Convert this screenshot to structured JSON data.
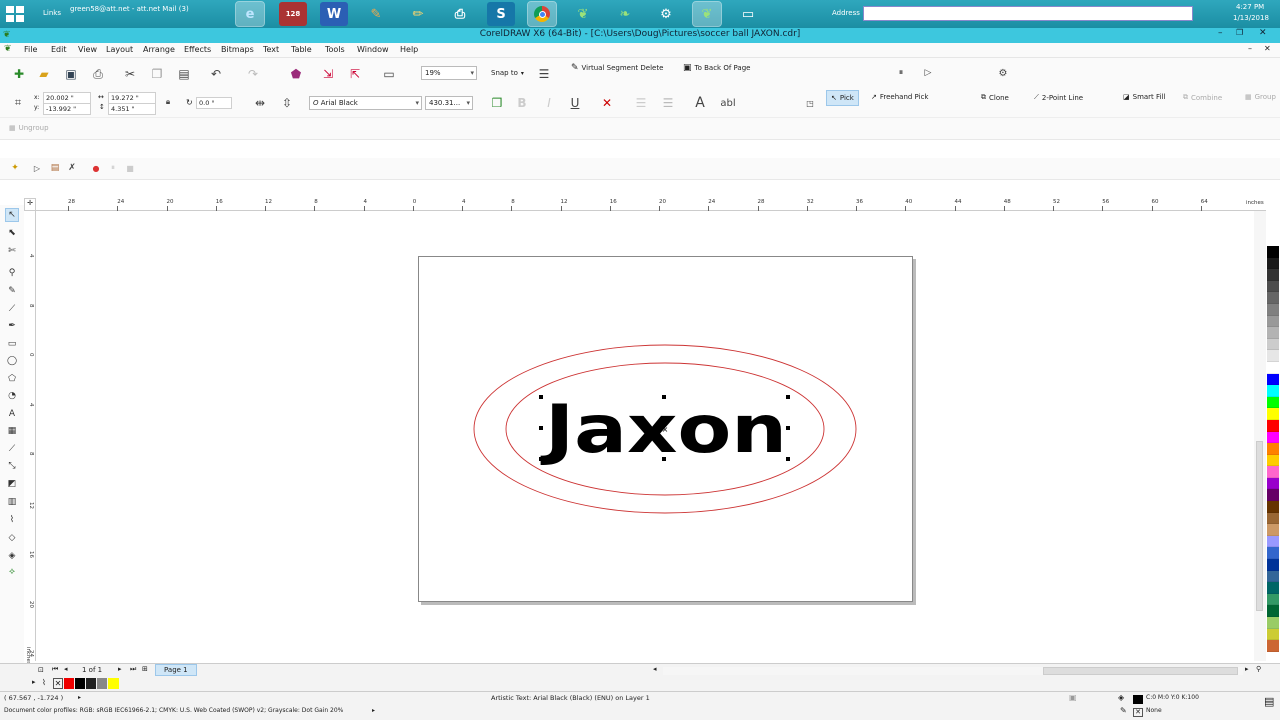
{
  "taskbar": {
    "bookmark_links": "Links",
    "mail_tab": "green58@att.net - att.net Mail (3)",
    "calendar_day": "128",
    "address_label": "Address",
    "clock_time": "4:27 PM",
    "clock_date": "1/13/2018"
  },
  "window": {
    "title": "CorelDRAW X6 (64-Bit) - [C:\\Users\\Doug\\Pictures\\soccer ball JAXON.cdr]"
  },
  "menu": [
    "File",
    "Edit",
    "View",
    "Layout",
    "Arrange",
    "Effects",
    "Bitmaps",
    "Text",
    "Table",
    "Tools",
    "Window",
    "Help"
  ],
  "standard_bar": {
    "zoom": "19%",
    "snap_to": "Snap to",
    "virtual_segment_delete": "Virtual Segment Delete",
    "to_back_of_page": "To Back Of Page"
  },
  "property_bar": {
    "x": "20.002 \"",
    "y": "-13.992 \"",
    "width": "19.272 \"",
    "height": "4.351 \"",
    "rotation": "0.0",
    "rotation_unit": "°",
    "font": "Arial Black",
    "font_size": "430.31...",
    "text_tool_glyph": "abl",
    "pick": "Pick",
    "freehand_pick": "Freehand Pick",
    "clone": "Clone",
    "two_point_line": "2-Point Line",
    "smart_fill": "Smart Fill",
    "combine": "Combine",
    "group": "Group",
    "ungroup": "Ungroup"
  },
  "rulers": {
    "h_labels": [
      "28",
      "24",
      "20",
      "16",
      "12",
      "8",
      "4",
      "0",
      "4",
      "8",
      "12",
      "16",
      "20",
      "24",
      "28",
      "32",
      "36",
      "40",
      "44",
      "48",
      "52",
      "56",
      "60",
      "64"
    ],
    "h_unit": "inches",
    "v_labels": [
      "4",
      "8",
      "0",
      "4",
      "8",
      "12",
      "16",
      "20",
      "24",
      "28"
    ],
    "v_unit": "inches"
  },
  "canvas": {
    "text_object": "Jaxon"
  },
  "page_nav": {
    "counter": "1 of 1",
    "page_tab": "Page 1"
  },
  "status": {
    "cursor_coords": "( 67.567 , -1.724 )",
    "object_info": "Artistic Text: Arial Black (Black) (ENU) on Layer 1",
    "fill_info": "C:0 M:0 Y:0 K:100",
    "outline_info": "None",
    "color_profiles": "Document color profiles: RGB: sRGB IEC61966-2.1; CMYK: U.S. Web Coated (SWOP) v2; Grayscale: Dot Gain 20%"
  },
  "colors": {
    "taskbar": "#1f97ac",
    "titlebar": "#3dc7de",
    "ellipse_outline": "#cc3333",
    "selection_highlight": "#cfe6f7"
  },
  "palette_colors": [
    "#000000",
    "#1a1a1a",
    "#333333",
    "#4d4d4d",
    "#666666",
    "#808080",
    "#999999",
    "#b3b3b3",
    "#cccccc",
    "#e6e6e6",
    "#ffffff",
    "#0000ff",
    "#00ffff",
    "#00ff00",
    "#ffff00",
    "#ff0000",
    "#ff00ff",
    "#ff8000",
    "#ffcc00",
    "#ff66cc",
    "#9900cc",
    "#660066",
    "#663300",
    "#996633",
    "#cc9966",
    "#9999ff",
    "#3366cc",
    "#003399",
    "#336699",
    "#006666",
    "#339966",
    "#006633",
    "#99cc66",
    "#cccc33",
    "#cc6633"
  ]
}
